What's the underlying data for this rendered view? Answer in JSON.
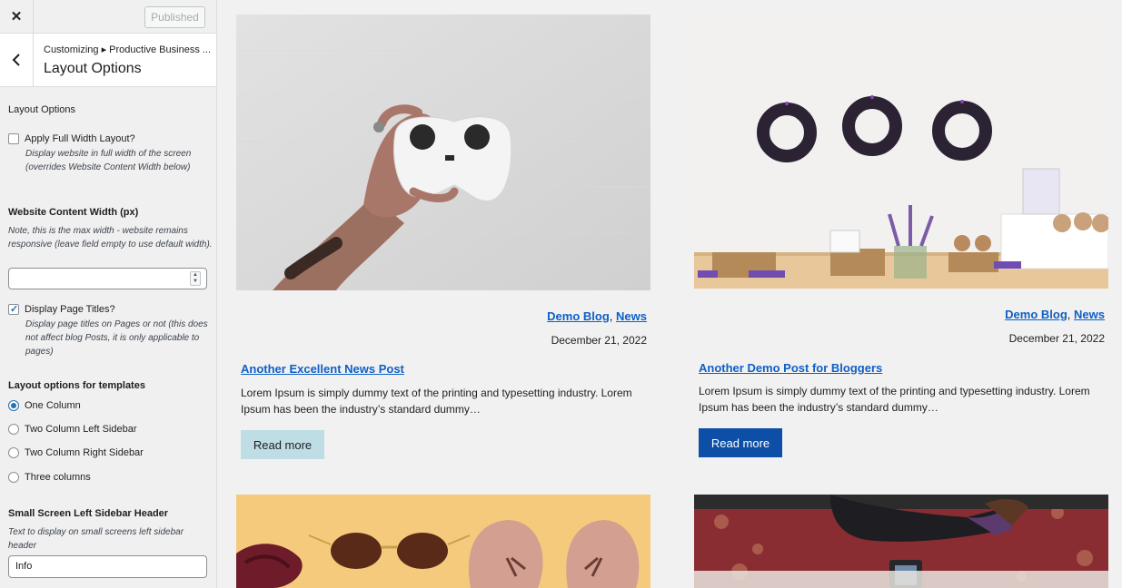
{
  "topbar": {
    "close_icon": "close-icon",
    "publish_label": "Published"
  },
  "section": {
    "breadcrumb": "Customizing ▸ Productive Business ...",
    "title": "Layout Options"
  },
  "controls": {
    "group_label": "Layout Options",
    "full_width": {
      "label": "Apply Full Width Layout?",
      "desc": "Display website in full width of the screen (overrides Website Content Width below)",
      "checked": false
    },
    "content_width": {
      "title": "Website Content Width (px)",
      "desc": "Note, this is the max width - website remains responsive (leave field empty to use default width).",
      "value": ""
    },
    "page_titles": {
      "label": "Display Page Titles?",
      "desc": "Display page titles on Pages or not (this does not affect blog Posts, it is only applicable to pages)",
      "checked": true
    },
    "templates": {
      "title": "Layout options for templates",
      "options": [
        "One Column",
        "Two Column Left Sidebar",
        "Two Column Right Sidebar",
        "Three columns"
      ],
      "selected": "One Column"
    },
    "sidebar_header": {
      "title": "Small Screen Left Sidebar Header",
      "desc": "Text to display on small screens left sidebar header",
      "value": "Info"
    }
  },
  "posts": [
    {
      "categories": [
        "Demo Blog",
        "News"
      ],
      "date": "December 21, 2022",
      "title": "Another Excellent News Post",
      "excerpt": "Lorem Ipsum is simply dummy text of the printing and typesetting industry. Lorem Ipsum has been the industry’s standard dummy…",
      "read_more": "Read more"
    },
    {
      "categories": [
        "Demo Blog",
        "News"
      ],
      "date": "December 21, 2022",
      "title": "Another Demo Post for Bloggers",
      "excerpt": "Lorem Ipsum is simply dummy text of the printing and typesetting industry. Lorem Ipsum has been the industry’s standard dummy…",
      "read_more": "Read more"
    }
  ],
  "colors": {
    "link": "#0f5fc6",
    "button_dark": "#0d4ea6",
    "button_light": "#bfdde5"
  }
}
